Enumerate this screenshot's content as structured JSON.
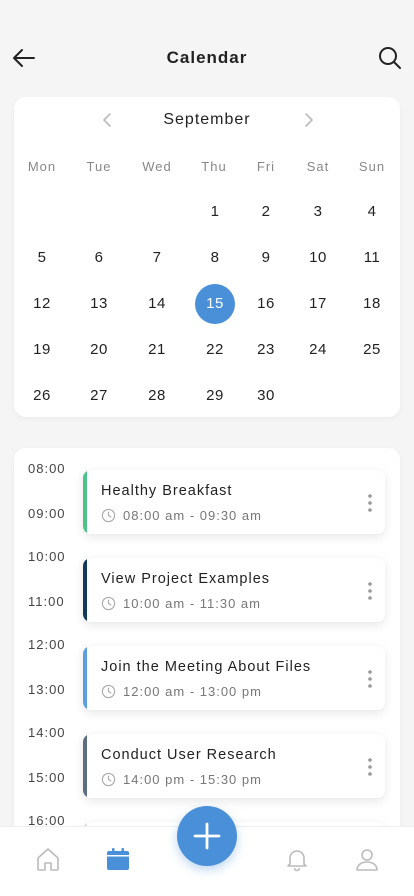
{
  "header": {
    "title": "Calendar"
  },
  "calendar": {
    "month": "September",
    "weekdays": [
      "Mon",
      "Tue",
      "Wed",
      "Thu",
      "Fri",
      "Sat",
      "Sun"
    ],
    "weeks": [
      [
        "",
        "",
        "",
        "1",
        "2",
        "3",
        "4"
      ],
      [
        "5",
        "6",
        "7",
        "8",
        "9",
        "10",
        "11"
      ],
      [
        "12",
        "13",
        "14",
        "15",
        "16",
        "17",
        "18"
      ],
      [
        "19",
        "20",
        "21",
        "22",
        "23",
        "24",
        "25"
      ],
      [
        "26",
        "27",
        "28",
        "29",
        "30",
        "",
        ""
      ]
    ],
    "selected_day": "15"
  },
  "schedule": {
    "times": [
      "08:00",
      "09:00",
      "10:00",
      "11:00",
      "12:00",
      "13:00",
      "14:00",
      "15:00",
      "16:00"
    ],
    "events": [
      {
        "title": "Healthy Breakfast",
        "time": "08:00 am - 09:30 am",
        "color": "#4cc38a"
      },
      {
        "title": "View Project Examples",
        "time": "10:00 am - 11:30 am",
        "color": "#0f3a5c"
      },
      {
        "title": "Join the Meeting About Files",
        "time": "12:00 am - 13:00 pm",
        "color": "#5aa0dc"
      },
      {
        "title": "Conduct User Research",
        "time": "14:00 pm - 15:30 pm",
        "color": "#5c6f80"
      }
    ]
  },
  "colors": {
    "accent": "#4a90d9"
  },
  "nav": {
    "items": [
      "home-icon",
      "calendar-icon",
      "add-icon",
      "bell-icon",
      "profile-icon"
    ],
    "active": "calendar-icon"
  }
}
